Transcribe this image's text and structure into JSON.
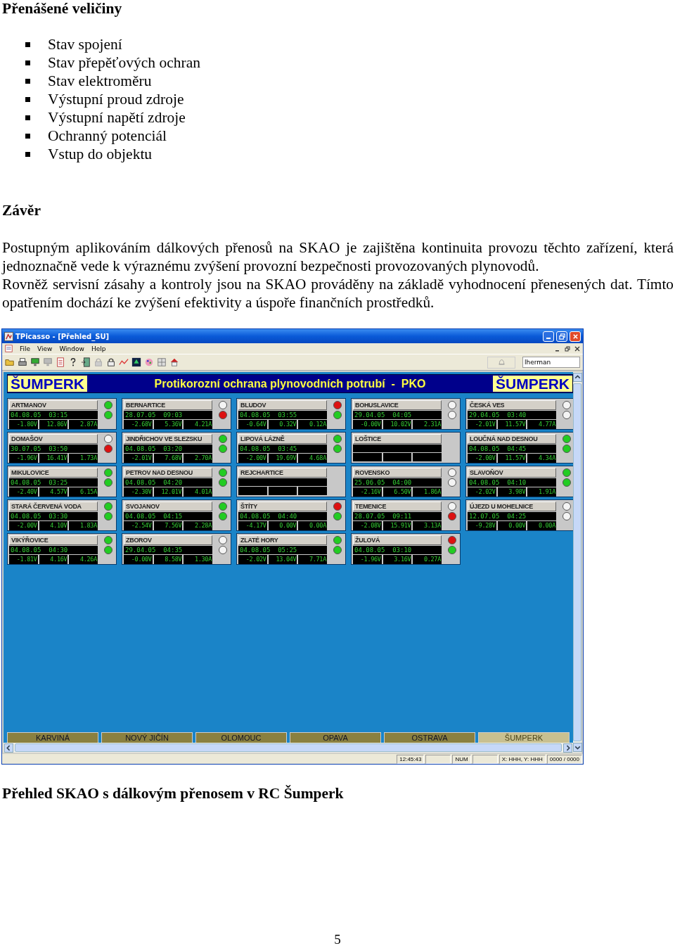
{
  "document": {
    "heading": "Přenášené veličiny",
    "bullets": [
      "Stav spojení",
      "Stav přepěťových ochran",
      "Stav elektroměru",
      "Výstupní proud zdroje",
      "Výstupní napětí zdroje",
      "Ochranný potenciál",
      "Vstup do objektu"
    ],
    "heading2": "Závěr",
    "paragraphs": [
      "Postupným aplikováním dálkových přenosů na SKAO je zajištěna kontinuita provozu těchto zařízení, která jednoznačně vede k výraznému zvýšení provozní bezpečnosti provozovaných plynovodů.",
      "Rovněž servisní zásahy  a kontroly jsou na SKAO prováděny na základě vyhodnocení přenesených dat. Tímto opatřením dochází ke zvýšení efektivity a úspoře finančních prostředků."
    ],
    "caption": "Přehled SKAO s dálkovým přenosem v RC Šumperk",
    "page_number": "5"
  },
  "app": {
    "title": "TPicasso - [Přehled_SU]",
    "menu": [
      "File",
      "View",
      "Window",
      "Help"
    ],
    "user": "lherman",
    "banner": {
      "left": "ŠUMPERK",
      "title": "Protikorozní ochrana plynovodních potrubí  -  PKO",
      "right": "ŠUMPERK"
    },
    "stations": [
      {
        "name": "ARTMANOV",
        "lamps": [
          {
            "color": "#22cc22"
          },
          {
            "color": "#22cc22"
          }
        ],
        "date": "04.08.05  03:15",
        "values": [
          "-1.80V",
          "12.86V",
          "2.87A"
        ]
      },
      {
        "name": "BERNARTICE",
        "lamps": [
          {
            "color": "#f4f4f4"
          },
          {
            "color": "#dd1111"
          }
        ],
        "date": "28.07.05  09:03",
        "values": [
          "-2.68V",
          "5.36V",
          "4.21A"
        ]
      },
      {
        "name": "BLUDOV",
        "lamps": [
          {
            "color": "#dd1111"
          },
          {
            "color": "#22cc22"
          }
        ],
        "date": "04.08.05  03:55",
        "values": [
          "-0.64V",
          "0.32V",
          "0.12A"
        ]
      },
      {
        "name": "BOHUSLAVICE",
        "lamps": [
          {
            "color": "#f4f4f4"
          },
          {
            "color": "#f4f4f4"
          }
        ],
        "date": "29.04.05  04:05",
        "values": [
          "-0.00V",
          "10.02V",
          "2.31A"
        ]
      },
      {
        "name": "ČESKÁ VES",
        "lamps": [
          {
            "color": "#f4f4f4"
          },
          {
            "color": "#f4f4f4"
          }
        ],
        "date": "29.04.05  03:40",
        "values": [
          "-2.01V",
          "11.57V",
          "4.77A"
        ]
      },
      {
        "name": "DOMAŠOV",
        "lamps": [
          {
            "color": "#f4f4f4"
          },
          {
            "color": "#dd1111"
          }
        ],
        "date": "30.07.05  03:50",
        "values": [
          "-1.96V",
          "16.41V",
          "1.73A"
        ]
      },
      {
        "name": "JINDŘICHOV VE SLEZSKU",
        "lamps": [
          {
            "color": "#22cc22"
          },
          {
            "color": "#22cc22"
          }
        ],
        "date": "04.08.05  03:20",
        "values": [
          "-2.01V",
          "7.68V",
          "2.70A"
        ]
      },
      {
        "name": "LIPOVÁ LÁZNĚ",
        "lamps": [
          {
            "color": "#22cc22"
          },
          {
            "color": "#22cc22"
          }
        ],
        "date": "04.08.05  03:45",
        "values": [
          "-2.00V",
          "19.69V",
          "4.68A"
        ]
      },
      {
        "name": "LOŠTICE"
      },
      {
        "name": "LOUČNÁ NAD DESNOU",
        "lamps": [
          {
            "color": "#22cc22"
          },
          {
            "color": "#22cc22"
          }
        ],
        "date": "04.08.05  04:45",
        "values": [
          "-2.00V",
          "11.57V",
          "4.34A"
        ]
      },
      {
        "name": "MIKULOVICE",
        "lamps": [
          {
            "color": "#22cc22"
          },
          {
            "color": "#22cc22"
          }
        ],
        "date": "04.08.05  03:25",
        "values": [
          "-2.40V",
          "4.57V",
          "6.15A"
        ]
      },
      {
        "name": "PETROV NAD DESNOU",
        "lamps": [
          {
            "color": "#22cc22"
          },
          {
            "color": "#22cc22"
          }
        ],
        "date": "04.08.05  04:20",
        "values": [
          "-2.30V",
          "12.01V",
          "4.01A"
        ]
      },
      {
        "name": "REJCHARTICE"
      },
      {
        "name": "ROVENSKO",
        "lamps": [
          {
            "color": "#f4f4f4"
          },
          {
            "color": "#f4f4f4"
          }
        ],
        "date": "25.06.05  04:00",
        "values": [
          "-2.16V",
          "6.50V",
          "1.86A"
        ]
      },
      {
        "name": "SLAVOŇOV",
        "lamps": [
          {
            "color": "#22cc22"
          },
          {
            "color": "#22cc22"
          }
        ],
        "date": "04.08.05  04:10",
        "values": [
          "-2.02V",
          "3.98V",
          "1.91A"
        ]
      },
      {
        "name": "STARÁ ČERVENÁ VODA",
        "lamps": [
          {
            "color": "#22cc22"
          },
          {
            "color": "#22cc22"
          }
        ],
        "date": "04.08.05  03:30",
        "values": [
          "-2.00V",
          "4.10V",
          "1.83A"
        ]
      },
      {
        "name": "SVOJANOV",
        "lamps": [
          {
            "color": "#22cc22"
          },
          {
            "color": "#22cc22"
          }
        ],
        "date": "04.08.05  04:15",
        "values": [
          "-2.54V",
          "7.56V",
          "2.28A"
        ]
      },
      {
        "name": "ŠTÍTY",
        "lamps": [
          {
            "color": "#dd1111"
          },
          {
            "color": "#22cc22"
          }
        ],
        "date": "04.08.05  04:40",
        "values": [
          "-4.17V",
          "0.00V",
          "0.00A"
        ]
      },
      {
        "name": "TEMENICE",
        "lamps": [
          {
            "color": "#f4f4f4"
          },
          {
            "color": "#dd1111"
          }
        ],
        "date": "28.07.05  09:11",
        "values": [
          "-2.08V",
          "15.91V",
          "3.13A"
        ]
      },
      {
        "name": "ÚJEZD U MOHELNICE",
        "lamps": [
          {
            "color": "#f4f4f4"
          },
          {
            "color": "#f4f4f4"
          }
        ],
        "date": "12.07.05  04:25",
        "values": [
          "-9.28V",
          "0.00V",
          "0.00A"
        ]
      },
      {
        "name": "VIKÝŘOVICE",
        "lamps": [
          {
            "color": "#22cc22"
          },
          {
            "color": "#22cc22"
          }
        ],
        "date": "04.08.05  04:30",
        "values": [
          "-1.81V",
          "4.16V",
          "4.26A"
        ]
      },
      {
        "name": "ZBOROV",
        "lamps": [
          {
            "color": "#f4f4f4"
          },
          {
            "color": "#f4f4f4"
          }
        ],
        "date": "29.04.05  04:35",
        "values": [
          "-0.00V",
          "8.58V",
          "1.30A"
        ]
      },
      {
        "name": "ZLATÉ HORY",
        "lamps": [
          {
            "color": "#22cc22"
          },
          {
            "color": "#22cc22"
          }
        ],
        "date": "04.08.05  05:25",
        "values": [
          "-2.02V",
          "13.04V",
          "7.71A"
        ]
      },
      {
        "name": "ŽULOVÁ",
        "lamps": [
          {
            "color": "#dd1111"
          },
          {
            "color": "#22cc22"
          }
        ],
        "date": "04.08.05  03:10",
        "values": [
          "-1.96V",
          "3.16V",
          "0.27A"
        ]
      }
    ],
    "tabs": [
      {
        "label": "KARVINÁ",
        "selected": false
      },
      {
        "label": "NOVÝ JIČÍN",
        "selected": false
      },
      {
        "label": "OLOMOUC",
        "selected": false
      },
      {
        "label": "OPAVA",
        "selected": false
      },
      {
        "label": "OSTRAVA",
        "selected": false
      },
      {
        "label": "ŠUMPERK",
        "selected": true
      }
    ],
    "status_bar": {
      "time": "12:45:43",
      "mode": "NUM",
      "coords": "X: HHH, Y: HHH",
      "count": "0000 / 0000"
    }
  }
}
